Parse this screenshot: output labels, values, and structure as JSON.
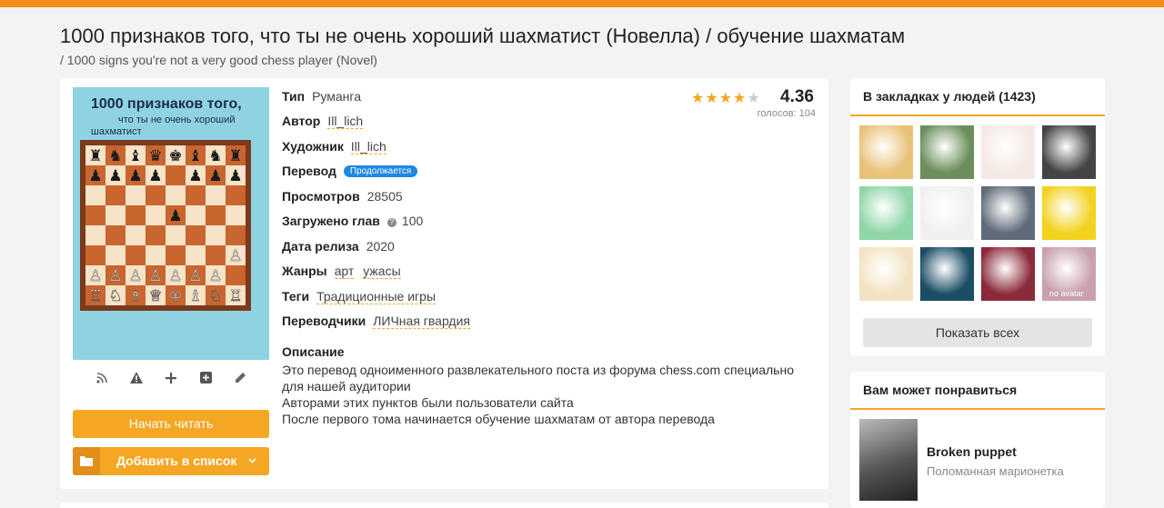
{
  "page": {
    "title": "1000 признаков того, что ты не очень хороший шахматист (Новелла) / обучение шахматам",
    "subtitle": "/ 1000 signs you're not a very good chess player (Novel)"
  },
  "cover": {
    "line1": "1000 признаков того,",
    "line2": "что ты не очень хороший",
    "line3": "шахматист"
  },
  "cover_icons": [
    "rss-icon",
    "warning-icon",
    "plus-icon",
    "plus-square-icon",
    "pencil-icon"
  ],
  "buttons": {
    "read": "Начать читать",
    "add_list": "Добавить в список"
  },
  "info": {
    "type_label": "Тип",
    "type_value": "Руманга",
    "author_label": "Автор",
    "author_value": "Ill_lich",
    "artist_label": "Художник",
    "artist_value": "Ill_lich",
    "translation_label": "Перевод",
    "translation_status": "Продолжается",
    "views_label": "Просмотров",
    "views_value": "28505",
    "chapters_label": "Загружено глав",
    "chapters_value": "100",
    "release_label": "Дата релиза",
    "release_value": "2020",
    "genres_label": "Жанры",
    "genres": [
      "арт",
      "ужасы"
    ],
    "tags_label": "Теги",
    "tags": [
      "Традиционные игры"
    ],
    "translators_label": "Переводчики",
    "translators": [
      "ЛИЧная гвардия"
    ]
  },
  "rating": {
    "score": "4.36",
    "stars": 4,
    "max_stars": 5,
    "votes": "голосов: 104"
  },
  "description": {
    "heading": "Описание",
    "lines": [
      "Это перевод одноименного развлекательного поста из форума chess.com специально",
      "для нашей аудитории",
      "Авторами этих пунктов были пользователи сайта",
      "После первого тома начинается обучение шахматам от автора перевода"
    ]
  },
  "bookmarks": {
    "heading": "В закладках у людей (1423)",
    "show_all": "Показать всех",
    "avatar_colors": [
      "#e9c27a",
      "#6b8e5a",
      "#f4e9e4",
      "#444444",
      "#8fd6a8",
      "#f0f0f0",
      "#5f6b78",
      "#f2d21e",
      "#f2e2c2",
      "#1b4d66",
      "#8a2a3a",
      "#caa0b0"
    ],
    "avatar_label_last": "no avatar"
  },
  "recommend": {
    "heading": "Вам может понравиться",
    "title": "Broken puppet",
    "subtitle": "Поломанная марионетка"
  },
  "colors": {
    "accent": "#f5a623",
    "badge": "#1e88e5"
  }
}
